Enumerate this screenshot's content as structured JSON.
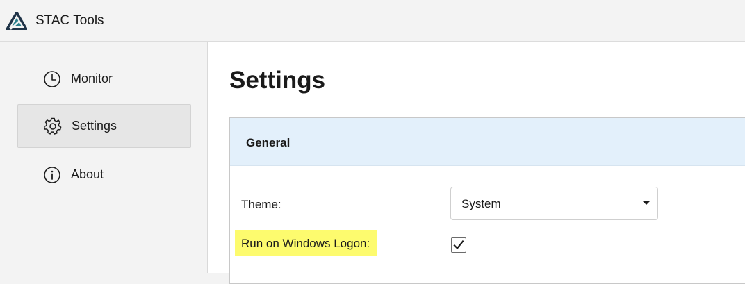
{
  "titlebar": {
    "app_title": "STAC Tools",
    "logo_icon": "stac-triangle-logo-icon"
  },
  "sidebar": {
    "items": [
      {
        "label": "Monitor",
        "icon": "clock-icon",
        "active": false
      },
      {
        "label": "Settings",
        "icon": "gear-icon",
        "active": true
      },
      {
        "label": "About",
        "icon": "info-icon",
        "active": false
      }
    ]
  },
  "main": {
    "page_title": "Settings",
    "section": {
      "title": "General",
      "theme_label": "Theme:",
      "theme_value": "System",
      "logon_label": "Run on Windows Logon:",
      "logon_checked": true
    }
  },
  "colors": {
    "logo_dark": "#1f3347",
    "logo_teal": "#2a7f8c",
    "section_header_bg": "#e3f0fb",
    "highlight": "#fdfb6e",
    "active_nav_bg": "#e6e6e6"
  }
}
